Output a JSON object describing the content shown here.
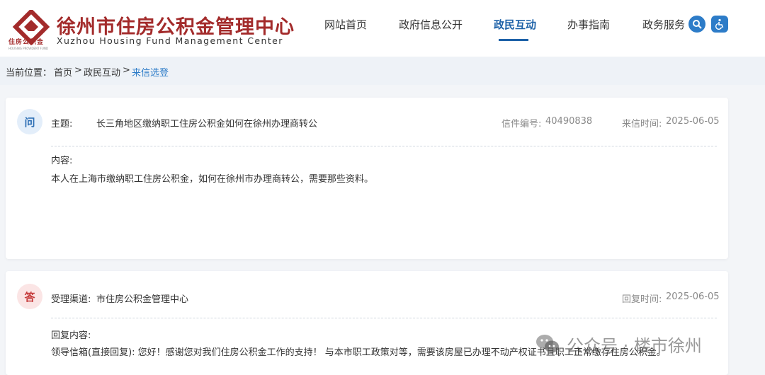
{
  "header": {
    "org_name": "徐州市住房公积金管理中心",
    "org_name_en": "Xuzhou Housing Fund Management Center",
    "logo_text": "住房公积金",
    "logo_tiny": "HOUSING PROVIDENT FUND",
    "nav": [
      {
        "label": "网站首页",
        "active": false
      },
      {
        "label": "政府信息公开",
        "active": false
      },
      {
        "label": "政民互动",
        "active": true
      },
      {
        "label": "办事指南",
        "active": false
      },
      {
        "label": "政务服务",
        "active": false
      }
    ],
    "colors": {
      "brand": "#a32b2b",
      "accent": "#1e62a8"
    }
  },
  "breadcrumb": {
    "prefix": "当前位置：",
    "home": "首页",
    "sep1": ">",
    "section": "政民互动",
    "sep2": ">",
    "current": "来信选登"
  },
  "question": {
    "badge": "问",
    "subject_label": "主题:",
    "subject": "长三角地区缴纳职工住房公积金如何在徐州办理商转公",
    "letter_no_label": "信件编号:",
    "letter_no": "40490838",
    "date_label": "来信时间:",
    "date": "2025-06-05",
    "content_label": "内容:",
    "content": "本人在上海市缴纳职工住房公积金，如何在徐州市办理商转公，需要那些资料。"
  },
  "answer": {
    "badge": "答",
    "channel_label": "受理渠道:",
    "channel": "市住房公积金管理中心",
    "date_label": "回复时间:",
    "date": "2025-06-05",
    "content_label": "回复内容:",
    "content": "领导信箱(直接回复): 您好！感谢您对我们住房公积金工作的支持！ 与本市职工政策对等，需要该房屋已办理不动产权证书且职工正常缴存住房公积金。"
  },
  "watermark": {
    "text": "公众号 · 楼市徐州"
  }
}
